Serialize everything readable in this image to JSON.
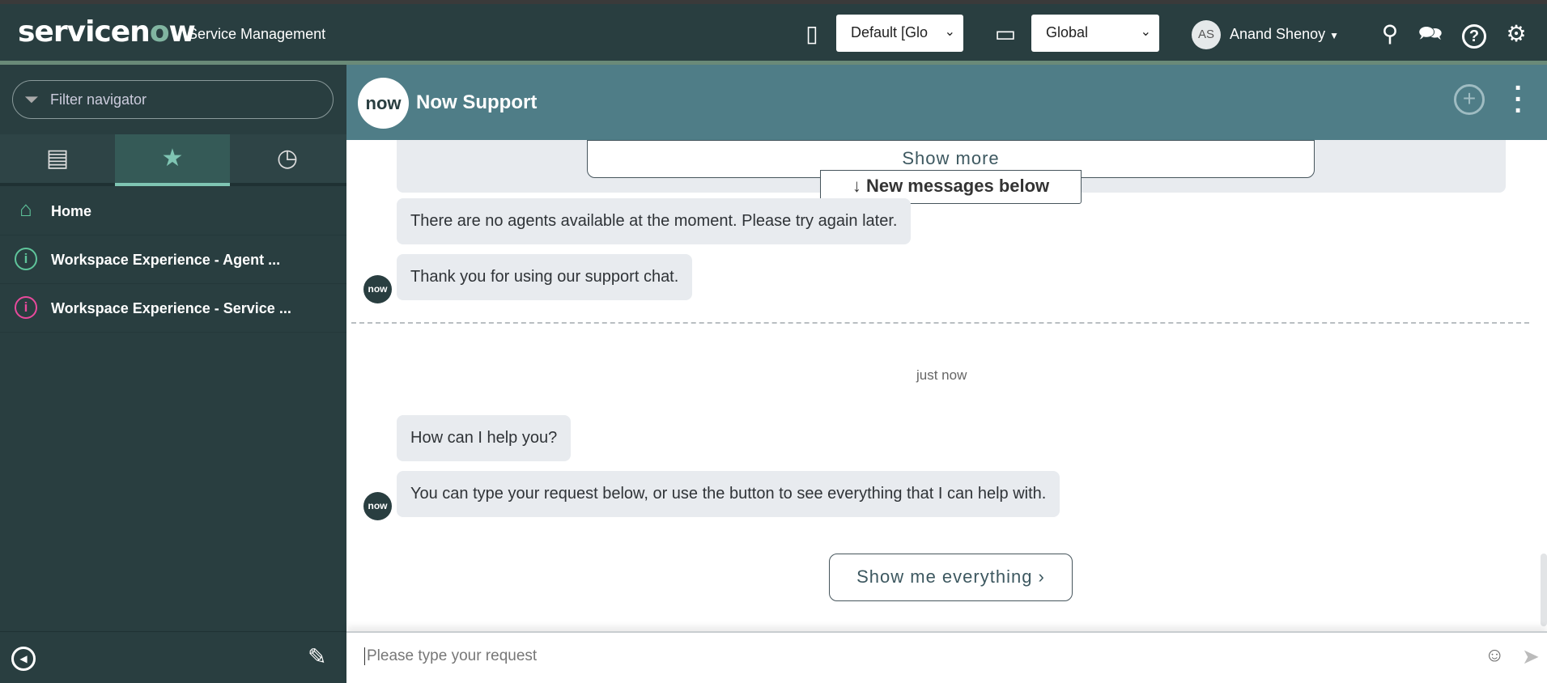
{
  "topbar": {
    "logo": "servicenow",
    "product": "Service Management",
    "update_set": "Default [Glo",
    "scope": "Global",
    "user_initials": "AS",
    "user_name": "Anand Shenoy"
  },
  "sidebar": {
    "filter_placeholder": "Filter navigator",
    "items": [
      {
        "label": "Home",
        "icon": "home-icon",
        "color": "#5fc59b"
      },
      {
        "label": "Workspace Experience - Agent ...",
        "icon": "info-icon",
        "color": "#5fc59b"
      },
      {
        "label": "Workspace Experience - Service ...",
        "icon": "info-icon",
        "color": "#e84a9c"
      }
    ]
  },
  "chat": {
    "logo": "now",
    "title": "Now Support",
    "show_more": "Show more",
    "new_messages": "↓ New messages below",
    "messages_before": [
      "There are no agents available at the moment. Please try again later.",
      "Thank you for using our support chat."
    ],
    "timestamp": "just now",
    "messages_after": [
      "How can I help you?",
      "You can type your request below, or use the button to see everything that I can help with."
    ],
    "show_everything": "Show me everything ›",
    "input_placeholder": "Please type your request"
  }
}
